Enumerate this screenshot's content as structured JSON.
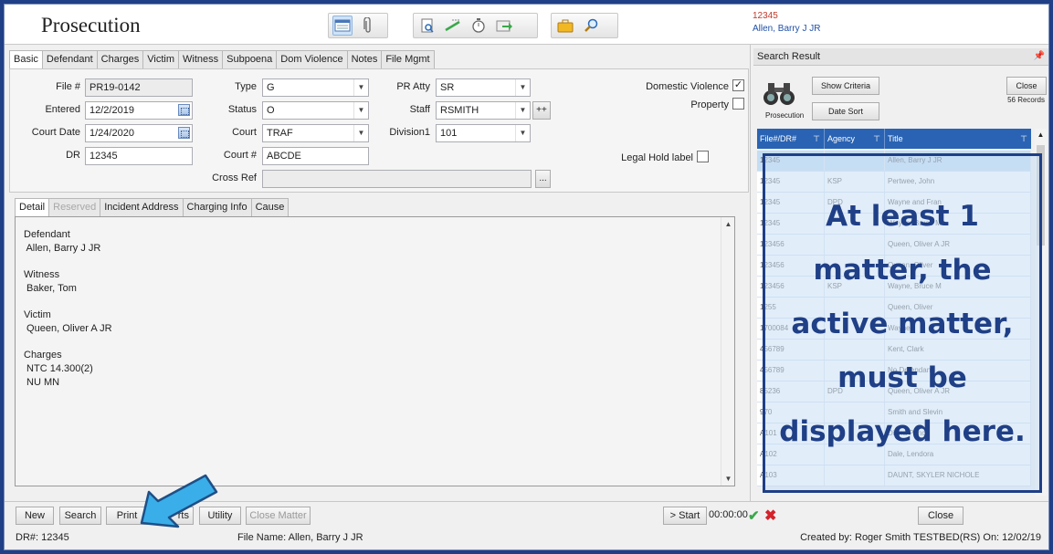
{
  "header": {
    "title": "Prosecution",
    "record_id": "12345",
    "record_name": "Allen, Barry J JR",
    "toolbar_icons": [
      "form-view-icon",
      "paperclip-icon",
      "print-preview-icon",
      "highlight-icon",
      "stopwatch-icon",
      "export-icon",
      "briefcase-icon",
      "search-icon"
    ]
  },
  "main_tabs": [
    "Basic",
    "Defendant",
    "Charges",
    "Victim",
    "Witness",
    "Subpoena",
    "Dom Violence",
    "Notes",
    "File Mgmt"
  ],
  "form": {
    "file_label": "File #",
    "file_value": "PR19-0142",
    "entered_label": "Entered",
    "entered_value": "12/2/2019",
    "court_date_label": "Court Date",
    "court_date_value": "1/24/2020",
    "dr_label": "DR",
    "dr_value": "12345",
    "type_label": "Type",
    "type_value": "G",
    "status_label": "Status",
    "status_value": "O",
    "court_label": "Court",
    "court_value": "TRAF",
    "court_num_label": "Court #",
    "court_num_value": "ABCDE",
    "cross_ref_label": "Cross Ref",
    "cross_ref_value": "",
    "cross_ref_button": "...",
    "pr_atty_label": "PR Atty",
    "pr_atty_value": "SR",
    "staff_label": "Staff",
    "staff_value": "RSMITH",
    "staff_add_button": "++",
    "division_label": "Division1",
    "division_value": "101",
    "domestic_violence_label": "Domestic Violence",
    "domestic_violence_checked": true,
    "property_label": "Property",
    "property_checked": false,
    "legal_hold_label": "Legal Hold label",
    "legal_hold_checked": false
  },
  "detail_tabs": [
    "Detail",
    "Reserved",
    "Incident Address",
    "Charging Info",
    "Cause"
  ],
  "detail_sections": [
    {
      "heading": "Defendant",
      "lines": [
        " Allen, Barry J JR"
      ]
    },
    {
      "heading": "Witness",
      "lines": [
        " Baker, Tom"
      ]
    },
    {
      "heading": "Victim",
      "lines": [
        " Queen, Oliver A JR"
      ]
    },
    {
      "heading": "Charges",
      "lines": [
        " NTC 14.300(2)",
        " NU MN"
      ]
    }
  ],
  "bottom_bar": {
    "new": "New",
    "search": "Search",
    "print": "Print",
    "reports_partial": "rts",
    "utility": "Utility",
    "close_matter": "Close Matter",
    "start": "> Start",
    "timer": "00:00:00",
    "close": "Close"
  },
  "status_bar": {
    "dr": "DR#: 12345",
    "file_name": "File Name: Allen, Barry J JR",
    "created": "Created by: Roger Smith TESTBED(RS) On: 12/02/19"
  },
  "search_result": {
    "title": "Search Result",
    "show_criteria": "Show Criteria",
    "date_sort": "Date Sort",
    "close": "Close",
    "count": "56 Records",
    "icon_caption": "Prosecution",
    "columns": [
      "File#/DR#",
      "Agency",
      "Title"
    ],
    "rows": [
      [
        "12345",
        "",
        "Allen, Barry J JR"
      ],
      [
        "12345",
        "KSP",
        "Pertwee, John"
      ],
      [
        "12345",
        "DPD",
        "Wayne and Fran"
      ],
      [
        "12345",
        "",
        "Wayne, Bruce M"
      ],
      [
        "123456",
        "",
        "Queen, Oliver A JR"
      ],
      [
        "123456",
        "",
        "Queen, Oliver"
      ],
      [
        "123456",
        "KSP",
        "Wayne, Bruce M"
      ],
      [
        "1255",
        "",
        "Queen, Oliver"
      ],
      [
        "1700084",
        "",
        "Wayne"
      ],
      [
        "456789",
        "",
        "Kent, Clark"
      ],
      [
        "456789",
        "",
        "No Defendant"
      ],
      [
        "85236",
        "DPD",
        "Queen, Oliver A JR"
      ],
      [
        "970",
        "",
        "Smith and Slevin"
      ],
      [
        "A101",
        "",
        "Diana Prince"
      ],
      [
        "A102",
        "",
        "Dale, Lendora"
      ],
      [
        "A103",
        "",
        "DAUNT, SKYLER NICHOLE"
      ]
    ]
  },
  "annotation": {
    "lines": [
      "At least 1",
      "matter, the",
      "active matter,",
      "must be",
      "displayed here."
    ],
    "box_color": "#1f3f86",
    "arrow_color": "#3aaee8"
  }
}
